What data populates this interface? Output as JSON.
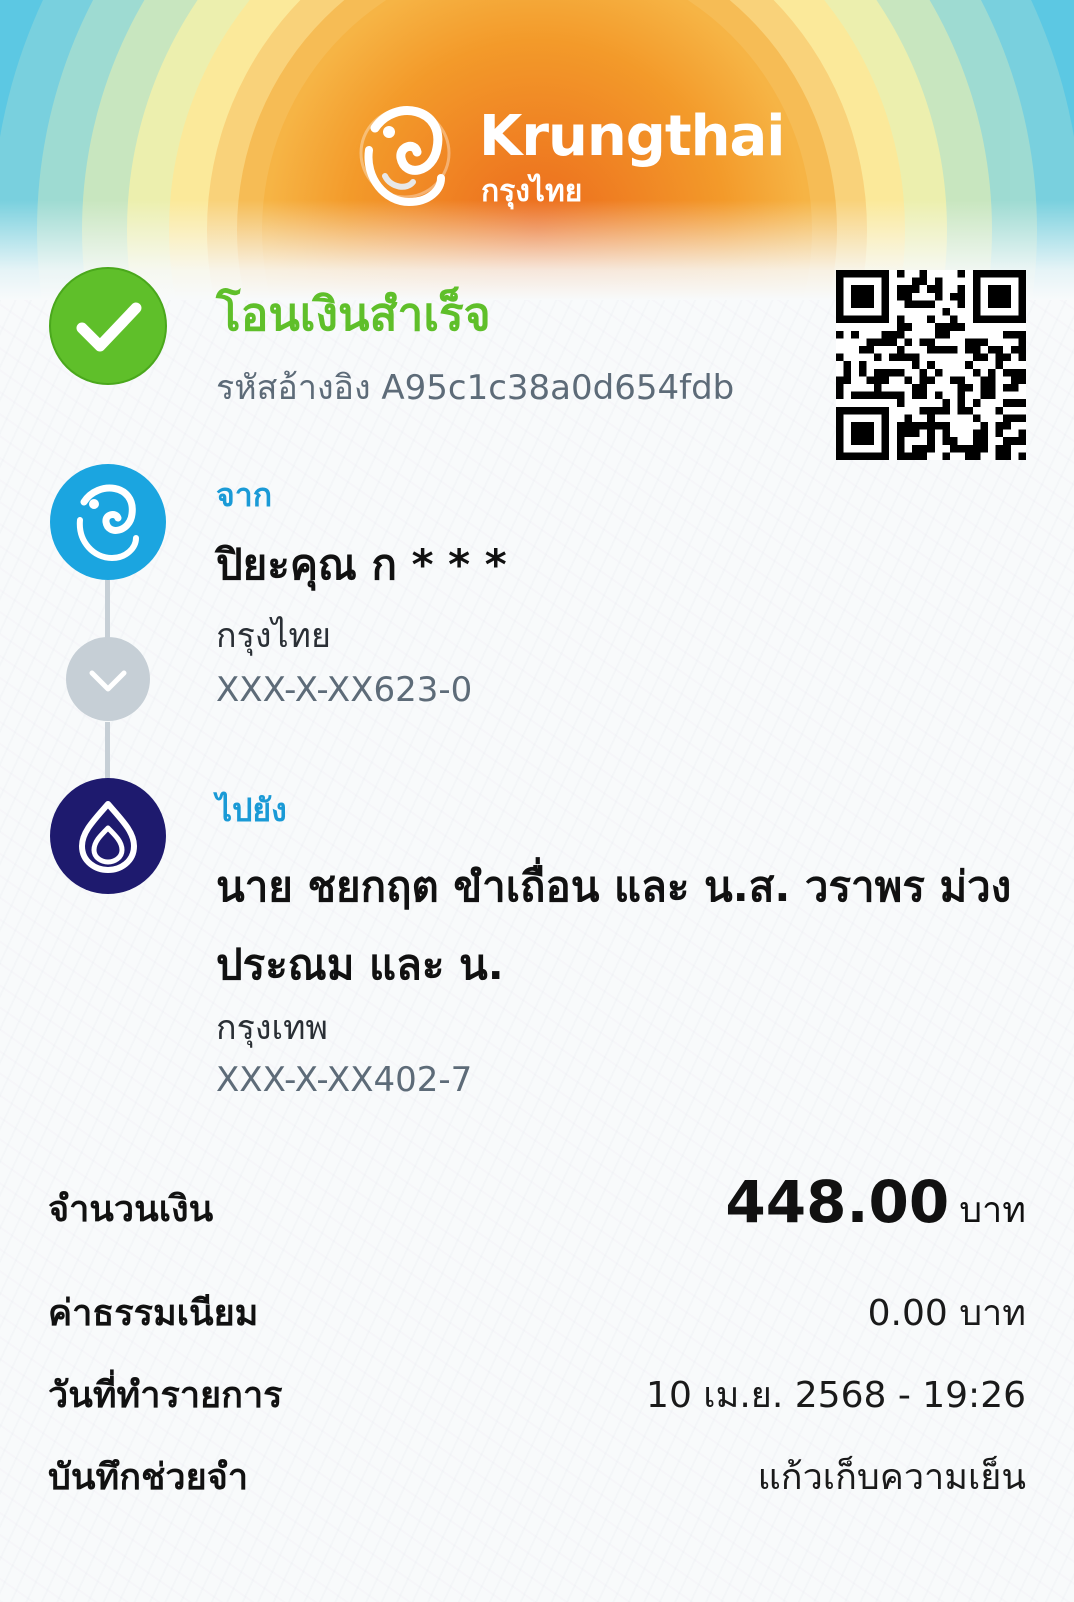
{
  "header": {
    "brand_name": "Krungthai",
    "brand_thai": "กรุงไทย"
  },
  "status": {
    "title": "โอนเงินสำเร็จ",
    "reference": "รหัสอ้างอิง A95c1c38a0d654fdb"
  },
  "from": {
    "label": "จาก",
    "name": "ปิยะคุณ ก * * *",
    "bank": "กรุงไทย",
    "account": "XXX-X-XX623-0"
  },
  "to": {
    "label": "ไปยัง",
    "name": "นาย ชยกฤต ขำเถื่อน และ น.ส. วราพร ม่วงประณม และ น.",
    "bank": "กรุงเทพ",
    "account": "XXX-X-XX402-7"
  },
  "details": {
    "amount_label": "จำนวนเงิน",
    "amount_value": "448.00",
    "amount_unit": "บาท",
    "fee_label": "ค่าธรรมเนียม",
    "fee_value": "0.00 บาท",
    "date_label": "วันที่ทำรายการ",
    "date_value": "10 เม.ย. 2568 - 19:26",
    "memo_label": "บันทึกช่วยจำ",
    "memo_value": "แก้วเก็บความเย็น"
  },
  "colors": {
    "success_green": "#5fbf2a",
    "label_blue": "#1a9ad6",
    "krungthai_blue": "#1ba5e0",
    "bangkok_navy": "#1e1a6e"
  },
  "icons": {
    "status": "check-icon",
    "from_bank": "krungthai-logo-icon",
    "to_bank": "bangkok-bank-logo-icon",
    "direction": "chevron-down-icon"
  }
}
